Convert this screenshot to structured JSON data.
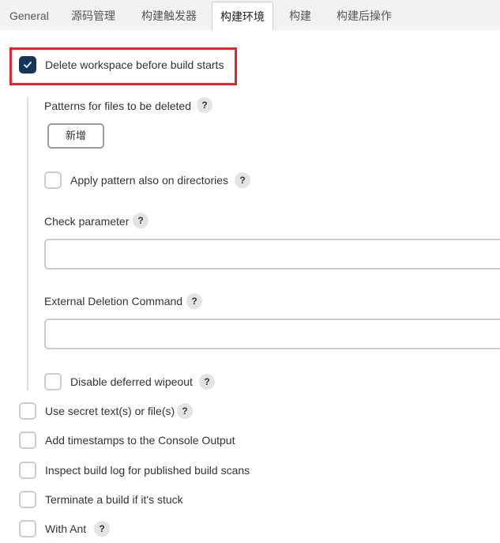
{
  "tabs": [
    {
      "label": "General",
      "active": false
    },
    {
      "label": "源码管理",
      "active": false
    },
    {
      "label": "构建触发器",
      "active": false
    },
    {
      "label": "构建环境",
      "active": true
    },
    {
      "label": "构建",
      "active": false
    },
    {
      "label": "构建后操作",
      "active": false
    }
  ],
  "options": {
    "delete_workspace": {
      "label": "Delete workspace before build starts",
      "checked": true
    },
    "patterns_label": "Patterns for files to be deleted",
    "add_button": "新增",
    "apply_pattern": {
      "label": "Apply pattern also on directories",
      "checked": false
    },
    "check_parameter": {
      "label": "Check parameter",
      "value": ""
    },
    "external_deletion": {
      "label": "External Deletion Command",
      "value": ""
    },
    "disable_deferred": {
      "label": "Disable deferred wipeout",
      "checked": false
    },
    "secret_text": {
      "label": "Use secret text(s) or file(s)",
      "checked": false
    },
    "timestamps": {
      "label": "Add timestamps to the Console Output",
      "checked": false
    },
    "inspect_log": {
      "label": "Inspect build log for published build scans",
      "checked": false
    },
    "terminate": {
      "label": "Terminate a build if it's stuck",
      "checked": false
    },
    "with_ant": {
      "label": "With Ant",
      "checked": false
    }
  },
  "help_glyph": "?",
  "colors": {
    "accent": "#14365d",
    "highlight": "#e8212b",
    "tabbar_bg": "#f2f2f2",
    "help_bg": "#e3e3e3"
  }
}
